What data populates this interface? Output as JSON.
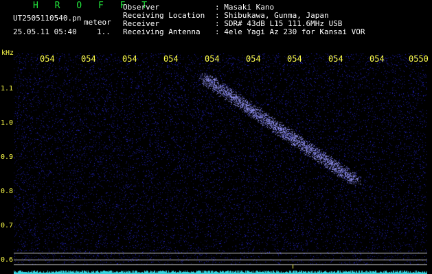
{
  "header": {
    "brand": "H R O F F T",
    "filename": "UT2505110540.pn",
    "mode": "meteor",
    "datetime": "25.05.11 05:40",
    "separator": "1.."
  },
  "info": [
    {
      "label": "Observer",
      "value": ": Masaki Kano"
    },
    {
      "label": "Receiving Location",
      "value": ": Shibukawa, Gunma, Japan"
    },
    {
      "label": "Receiver",
      "value": ": SDR# 43dB L15 111.6MHz USB"
    },
    {
      "label": "Receiving Antenna",
      "value": ": 4ele Yagi Az 230 for Kansai VOR"
    }
  ],
  "axis": {
    "y_unit": "kHz",
    "x_ticks": [
      "054",
      "054",
      "054",
      "054",
      "054",
      "054",
      "054",
      "054",
      "054",
      "0550"
    ],
    "y_ticks": [
      "1.1",
      "1.0",
      "0.9",
      "0.8",
      "0.7",
      "0.6"
    ]
  },
  "colors": {
    "background": "#000000",
    "noise": "#1a1aa8",
    "trail": "#a8a8ff",
    "axis_text": "#ffff4a",
    "brand": "#22e63c",
    "baseline": "#39d4e0"
  }
}
